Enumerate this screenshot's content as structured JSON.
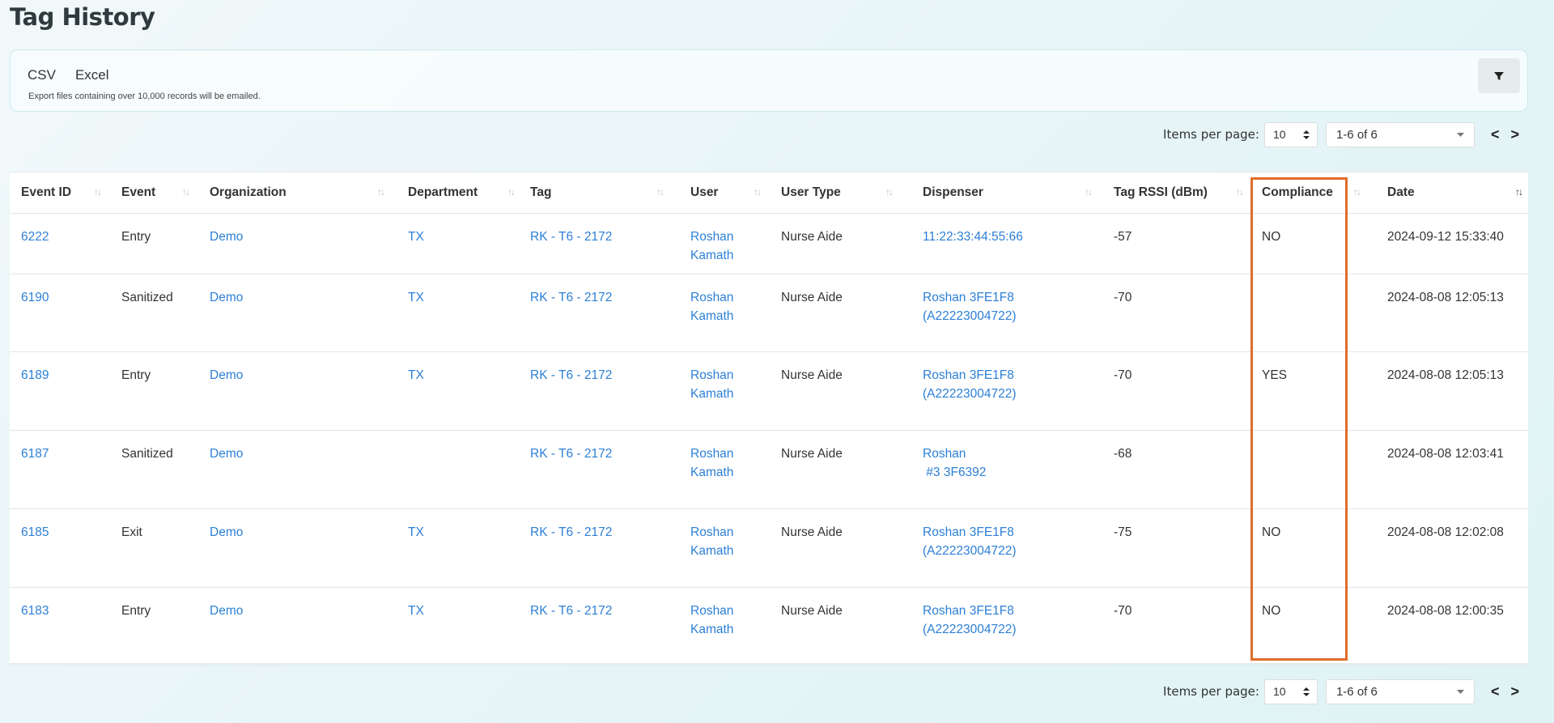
{
  "page": {
    "title": "Tag History"
  },
  "export": {
    "csv_label": "CSV",
    "excel_label": "Excel",
    "note": "Export files containing over 10,000 records will be emailed."
  },
  "filter_icon": "filter-icon",
  "pagination": {
    "items_per_page_label": "Items per page:",
    "items_per_page_value": "10",
    "range_value": "1-6 of 6",
    "prev_symbol": "<",
    "next_symbol": ">"
  },
  "table": {
    "columns": [
      "Event ID",
      "Event",
      "Organization",
      "Department",
      "Tag",
      "User",
      "User Type",
      "Dispenser",
      "Tag RSSI (dBm)",
      "Compliance",
      "Date"
    ],
    "rows": [
      {
        "event_id": "6222",
        "event": "Entry",
        "organization": "Demo",
        "department": "TX",
        "tag": "RK - T6 - 2172",
        "user_first": "Roshan",
        "user_last": "Kamath",
        "user_type": "Nurse Aide",
        "dispenser_line1": "11:22:33:44:55:66",
        "dispenser_line2": "",
        "rssi": "-57",
        "compliance": "NO",
        "date": "2024-09-12 15:33:40"
      },
      {
        "event_id": "6190",
        "event": "Sanitized",
        "organization": "Demo",
        "department": "TX",
        "tag": "RK - T6 - 2172",
        "user_first": "Roshan",
        "user_last": "Kamath",
        "user_type": "Nurse Aide",
        "dispenser_line1": "Roshan 3FE1F8",
        "dispenser_line2": "(A22223004722)",
        "rssi": "-70",
        "compliance": "",
        "date": "2024-08-08 12:05:13"
      },
      {
        "event_id": "6189",
        "event": "Entry",
        "organization": "Demo",
        "department": "TX",
        "tag": "RK - T6 - 2172",
        "user_first": "Roshan",
        "user_last": "Kamath",
        "user_type": "Nurse Aide",
        "dispenser_line1": "Roshan 3FE1F8",
        "dispenser_line2": "(A22223004722)",
        "rssi": "-70",
        "compliance": "YES",
        "date": "2024-08-08 12:05:13"
      },
      {
        "event_id": "6187",
        "event": "Sanitized",
        "organization": "Demo",
        "department": "",
        "tag": "RK - T6 - 2172",
        "user_first": "Roshan",
        "user_last": "Kamath",
        "user_type": "Nurse Aide",
        "dispenser_line1": "Roshan",
        "dispenser_line2": " #3 3F6392",
        "rssi": "-68",
        "compliance": "",
        "date": "2024-08-08 12:03:41"
      },
      {
        "event_id": "6185",
        "event": "Exit",
        "organization": "Demo",
        "department": "TX",
        "tag": "RK - T6 - 2172",
        "user_first": "Roshan",
        "user_last": "Kamath",
        "user_type": "Nurse Aide",
        "dispenser_line1": "Roshan 3FE1F8",
        "dispenser_line2": "(A22223004722)",
        "rssi": "-75",
        "compliance": "NO",
        "date": "2024-08-08 12:02:08"
      },
      {
        "event_id": "6183",
        "event": "Entry",
        "organization": "Demo",
        "department": "TX",
        "tag": "RK - T6 - 2172",
        "user_first": "Roshan",
        "user_last": "Kamath",
        "user_type": "Nurse Aide",
        "dispenser_line1": "Roshan 3FE1F8",
        "dispenser_line2": "(A22223004722)",
        "rssi": "-70",
        "compliance": "NO",
        "date": "2024-08-08 12:00:35"
      }
    ]
  },
  "colors": {
    "link": "#2c7fd6",
    "highlight": "#e06d2b"
  }
}
